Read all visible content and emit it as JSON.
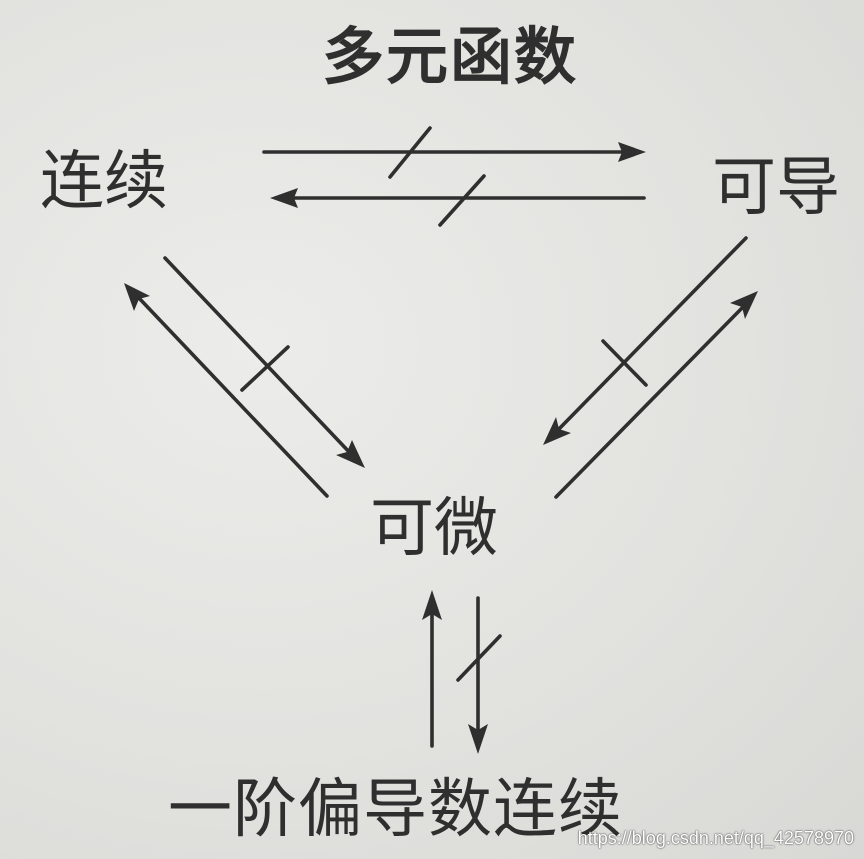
{
  "title": "多元函数",
  "nodes": {
    "continuous": "连续",
    "derivable": "可导",
    "differentiable": "可微",
    "partials_continuous": "一阶偏导数连续"
  },
  "watermark": "https://blog.csdn.net/qq_42578970",
  "colors": {
    "ink": "#2f2f2f",
    "paper": "#e4e4e2"
  },
  "relations": [
    {
      "from": "continuous",
      "to": "derivable",
      "implies": false
    },
    {
      "from": "derivable",
      "to": "continuous",
      "implies": false
    },
    {
      "from": "continuous",
      "to": "differentiable",
      "implies": false
    },
    {
      "from": "differentiable",
      "to": "continuous",
      "implies": true
    },
    {
      "from": "derivable",
      "to": "differentiable",
      "implies": false
    },
    {
      "from": "differentiable",
      "to": "derivable",
      "implies": true
    },
    {
      "from": "partials_continuous",
      "to": "differentiable",
      "implies": true
    },
    {
      "from": "differentiable",
      "to": "partials_continuous",
      "implies": false
    }
  ]
}
